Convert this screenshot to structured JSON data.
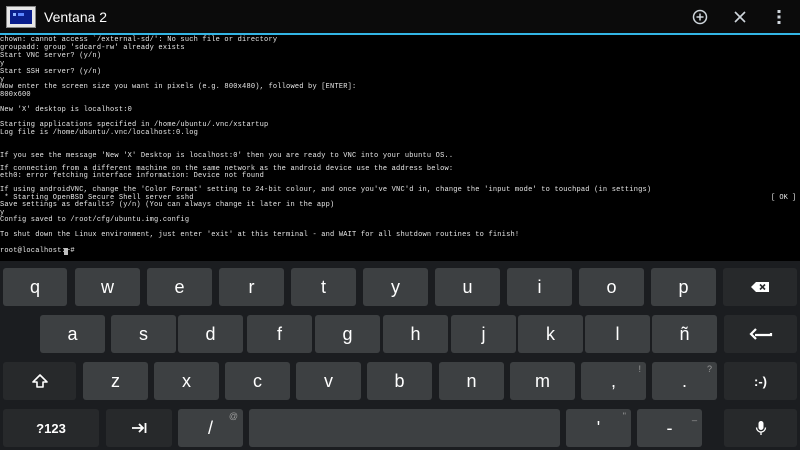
{
  "window": {
    "title": "Ventana 2",
    "accent_color": "#33b5e5",
    "actions": [
      {
        "name": "add-tab-button",
        "icon": "plus-circle-icon"
      },
      {
        "name": "close-window-button",
        "icon": "close-icon"
      },
      {
        "name": "overflow-menu-button",
        "icon": "overflow-menu-icon"
      }
    ]
  },
  "terminal": {
    "lines": [
      "chown: cannot access `/external-sd/': No such file or directory",
      "groupadd: group 'sdcard-rw' already exists",
      "Start VNC server? (y/n)",
      "y",
      "Start SSH server? (y/n)",
      "y",
      "Now enter the screen size you want in pixels (e.g. 800x480), followed by [ENTER]:",
      "800x600",
      "",
      "New 'X' desktop is localhost:0",
      "",
      "Starting applications specified in /home/ubuntu/.vnc/xstartup",
      "Log file is /home/ubuntu/.vnc/localhost:0.log",
      "",
      "",
      "If you see the message 'New 'X' Desktop is localhost:0' then you are ready to VNC into your ubuntu OS..",
      "",
      "If connection from a different machine on the same network as the android device use the address below:",
      "eth0: error fetching interface information: Device not found",
      "",
      "If using androidVNC, change the 'Color Format' setting to 24-bit colour, and once you've VNC'd in, change the 'input mode' to touchpad (in settings)",
      " * Starting OpenBSD Secure Shell server sshd",
      "Save settings as defaults? (y/n) (You can always change it later in the app)",
      "y",
      "Config saved to /root/cfg/ubuntu.img.config",
      "",
      "To shut down the Linux environment, just enter 'exit' at this terminal - and WAIT for all shutdown routines to finish!",
      "",
      "root@localhost:~#"
    ],
    "ok_badge": "[ OK ]"
  },
  "keyboard": {
    "rows": [
      [
        {
          "label": "q",
          "name": "key-q"
        },
        {
          "label": "w",
          "name": "key-w"
        },
        {
          "label": "e",
          "name": "key-e"
        },
        {
          "label": "r",
          "name": "key-r"
        },
        {
          "label": "t",
          "name": "key-t"
        },
        {
          "label": "y",
          "name": "key-y"
        },
        {
          "label": "u",
          "name": "key-u"
        },
        {
          "label": "i",
          "name": "key-i"
        },
        {
          "label": "o",
          "name": "key-o"
        },
        {
          "label": "p",
          "name": "key-p"
        },
        {
          "label": "",
          "name": "backspace-key",
          "icon": "backspace-icon"
        }
      ],
      [
        {
          "label": "a",
          "name": "key-a"
        },
        {
          "label": "s",
          "name": "key-s"
        },
        {
          "label": "d",
          "name": "key-d"
        },
        {
          "label": "f",
          "name": "key-f"
        },
        {
          "label": "g",
          "name": "key-g"
        },
        {
          "label": "h",
          "name": "key-h"
        },
        {
          "label": "j",
          "name": "key-j"
        },
        {
          "label": "k",
          "name": "key-k"
        },
        {
          "label": "l",
          "name": "key-l"
        },
        {
          "label": "ñ",
          "name": "key-n-tilde"
        },
        {
          "label": "",
          "name": "enter-key",
          "icon": "enter-icon"
        }
      ],
      [
        {
          "label": "",
          "name": "shift-key",
          "icon": "shift-icon"
        },
        {
          "label": "z",
          "name": "key-z"
        },
        {
          "label": "x",
          "name": "key-x"
        },
        {
          "label": "c",
          "name": "key-c"
        },
        {
          "label": "v",
          "name": "key-v"
        },
        {
          "label": "b",
          "name": "key-b"
        },
        {
          "label": "n",
          "name": "key-n"
        },
        {
          "label": "m",
          "name": "key-m"
        },
        {
          "label": ",",
          "hint": "!",
          "name": "key-comma"
        },
        {
          "label": ".",
          "hint": "?",
          "name": "key-period"
        },
        {
          "label": ":-)",
          "name": "smiley-key"
        }
      ],
      [
        {
          "label": "?123",
          "name": "symbols-key"
        },
        {
          "label": "",
          "name": "tab-key",
          "icon": "tab-icon"
        },
        {
          "label": "/",
          "hint": "@",
          "name": "key-slash"
        },
        {
          "label": "",
          "name": "space-bar"
        },
        {
          "label": "'",
          "hint": "\"",
          "name": "key-apostrophe"
        },
        {
          "label": "-",
          "hint": "_",
          "name": "key-dash"
        },
        {
          "label": "",
          "name": "voice-input-key",
          "icon": "microphone-icon"
        }
      ]
    ]
  }
}
